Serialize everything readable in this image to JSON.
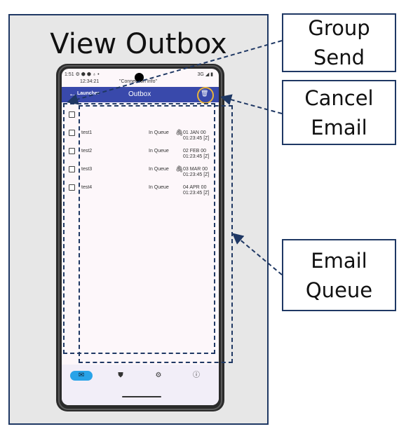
{
  "panel": {
    "title": "View Outbox"
  },
  "callouts": {
    "group_send": "Group\nSend",
    "cancel_email": "Cancel\nEmail",
    "email_queue": "Email\nQueue"
  },
  "status_bar": {
    "left": "1:51 ⚙ ⬢ ⬢ ♁ •",
    "right": "3G ◢ ▮",
    "clock": "12:34:21",
    "info": "\"Connection Info\""
  },
  "app_bar": {
    "back_icon": "arrow-left-icon",
    "back_label": "Launcher",
    "title": "Outbox",
    "action_icon": "trash-icon"
  },
  "emails": [
    {
      "subject": "test1",
      "status": "In Queue",
      "attachment": true,
      "date": "01 JAN 00",
      "time": "01:23:45 [Z]"
    },
    {
      "subject": "test2",
      "status": "In Queue",
      "attachment": false,
      "date": "02 FEB 00",
      "time": "01:23:45 [Z]"
    },
    {
      "subject": "test3",
      "status": "In Queue",
      "attachment": true,
      "date": "03 MAR 00",
      "time": "01:23:45 [Z]"
    },
    {
      "subject": "test4",
      "status": "In Queue",
      "attachment": false,
      "date": "04 APR 00",
      "time": "01:23:45 [Z]"
    }
  ],
  "bottom_nav": [
    {
      "icon": "mail-icon",
      "glyph": "✉",
      "active": true
    },
    {
      "icon": "shield-icon",
      "glyph": "⛊",
      "active": false
    },
    {
      "icon": "gear-icon",
      "glyph": "⚙",
      "active": false
    },
    {
      "icon": "info-icon",
      "glyph": "ⓘ",
      "active": false
    }
  ],
  "colors": {
    "accent": "#3949ab",
    "nav_active": "#29a3e8",
    "callout_border": "#1f3864",
    "highlight": "#e8b339"
  }
}
